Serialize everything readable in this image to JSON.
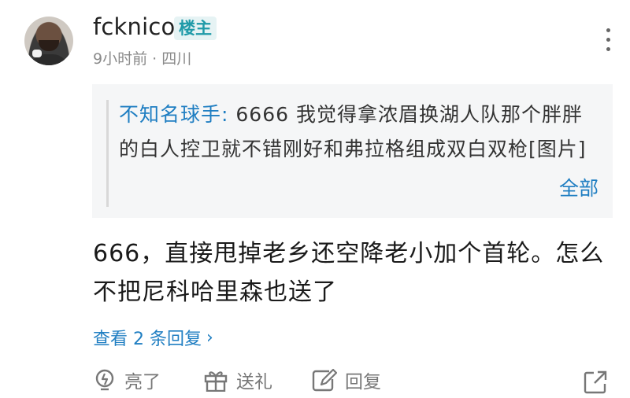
{
  "user": {
    "name": "fcknico",
    "badge": "楼主",
    "time": "9小时前",
    "separator": "·",
    "location": "四川"
  },
  "quote": {
    "author": "不知名球手:",
    "text": " 6666 我觉得拿浓眉换湖人队那个胖胖的白人控卫就不错刚好和弗拉格组成双白双枪[图片]",
    "expand_label": "全部"
  },
  "reply": {
    "text": "666，直接甩掉老乡还空降老小加个首轮。怎么不把尼科哈里森也送了"
  },
  "view_replies": {
    "label": "查看 2 条回复",
    "chevron": "›"
  },
  "actions": {
    "light_label": "亮了",
    "gift_label": "送礼",
    "reply_label": "回复"
  },
  "icons": {
    "more": "more-vertical-icon",
    "light": "lightbulb-icon",
    "gift": "gift-icon",
    "reply": "edit-reply-icon",
    "share": "share-icon"
  },
  "colors": {
    "accent_blue": "#1f7ec2",
    "badge_bg": "#e6f3f4",
    "badge_text": "#1f9aa8",
    "quote_bg": "#f5f6f7"
  }
}
